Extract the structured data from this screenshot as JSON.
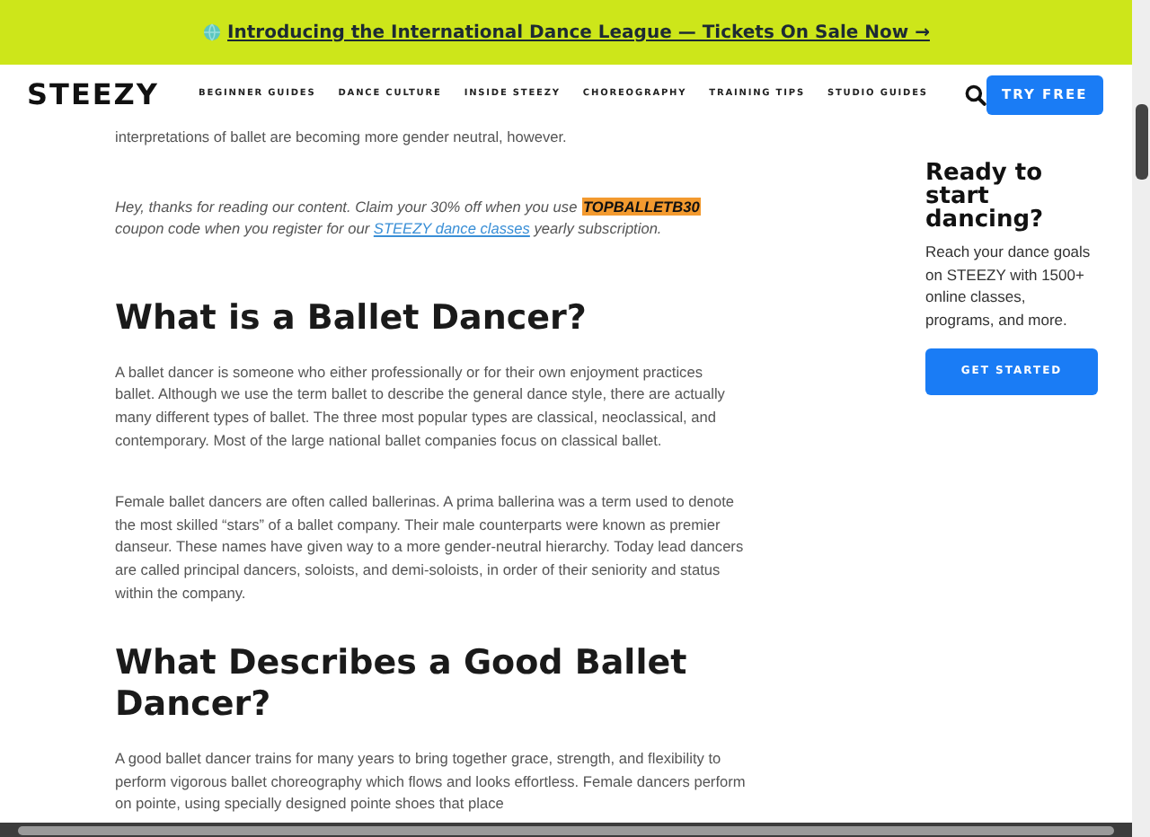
{
  "banner": {
    "text": "Introducing the International Dance League — Tickets On Sale Now →"
  },
  "nav": {
    "logo": "STEEZY",
    "links": [
      "BEGINNER GUIDES",
      "DANCE CULTURE",
      "INSIDE STEEZY",
      "CHOREOGRAPHY",
      "TRAINING TIPS",
      "STUDIO GUIDES"
    ],
    "cta": "TRY FREE"
  },
  "article": [
    {
      "kind": "paragraph",
      "text": "interpretations of ballet are becoming more gender neutral, however."
    },
    {
      "kind": "promo",
      "before": "Hey, thanks for reading our content. Claim your 30% off when you use ",
      "code": "TOPBALLETB30",
      "middle": " coupon code when you register for our ",
      "link": "STEEZY dance classes",
      "after": " yearly subscription."
    },
    {
      "kind": "heading",
      "text": "What is a Ballet Dancer?"
    },
    {
      "kind": "paragraph",
      "text": "A ballet dancer is someone who either professionally or for their own enjoyment practices ballet. Although we use the term ballet to describe the general dance style, there are actually many different types of ballet. The three most popular types are classical, neoclassical, and contemporary. Most of the large national ballet companies focus on classical ballet."
    },
    {
      "kind": "paragraph",
      "text": "Female ballet dancers are often called ballerinas. A prima ballerina was a term used to denote the most skilled “stars” of a ballet company. Their male counterparts were known as premier danseur. These names have given way to a more gender-neutral hierarchy. Today lead dancers are called principal dancers, soloists, and demi-soloists, in order of their seniority and status within the company."
    },
    {
      "kind": "heading",
      "text": "What Describes a Good Ballet Dancer?"
    },
    {
      "kind": "paragraph",
      "text": "A good ballet dancer trains for many years to bring together grace, strength, and flexibility to perform vigorous ballet choreography which flows and looks effortless. Female dancers perform on pointe, using specially designed pointe shoes that place"
    }
  ],
  "sidebar": {
    "title": "Ready to start dancing?",
    "text": "Reach your dance goals on STEEZY with 1500+ online classes, programs, and more.",
    "button": "GET STARTED"
  }
}
